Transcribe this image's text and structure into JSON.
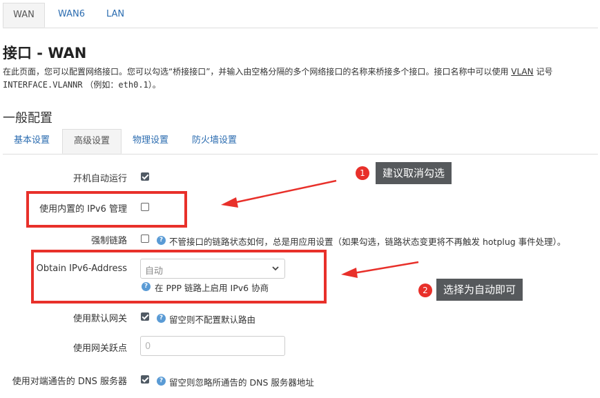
{
  "top_tabs": [
    {
      "label": "WAN",
      "active": true
    },
    {
      "label": "WAN6",
      "active": false
    },
    {
      "label": "LAN",
      "active": false
    }
  ],
  "page": {
    "title": "接口 - WAN",
    "desc_line1_a": "在此页面，您可以配置网络接口。您可以勾选“桥接接口”，并输入由空格分隔的多个网络接口的名称来桥接多个接口。接口名称中可以使用 ",
    "desc_line1_vlan": "VLAN",
    "desc_line1_b": " 记号",
    "desc_line2_code": "INTERFACE.VLANNR",
    "desc_line2_mid": " （例如：",
    "desc_line2_example": "eth0.1",
    "desc_line2_end": "）。"
  },
  "section": {
    "title": "一般配置"
  },
  "sub_tabs": [
    {
      "label": "基本设置",
      "active": false
    },
    {
      "label": "高级设置",
      "active": true
    },
    {
      "label": "物理设置",
      "active": false
    },
    {
      "label": "防火墙设置",
      "active": false
    }
  ],
  "form": {
    "auto_start": {
      "label": "开机自动运行",
      "checked": true
    },
    "ipv6_mgmt": {
      "label": "使用内置的 IPv6 管理",
      "checked": false
    },
    "force_link": {
      "label": "强制链路",
      "checked": false,
      "help": "不管接口的链路状态如何，总是用应用设置（如果勾选，链路状态变更将不再触发 hotplug 事件处理）。"
    },
    "obtain_ipv6": {
      "label": "Obtain IPv6-Address",
      "value": "自动",
      "help": "在 PPP 链路上启用 IPv6 协商"
    },
    "default_gw": {
      "label": "使用默认网关",
      "checked": true,
      "help": "留空则不配置默认路由"
    },
    "gw_metric": {
      "label": "使用网关跃点",
      "placeholder": "0"
    },
    "peer_dns": {
      "label": "使用对端通告的 DNS 服务器",
      "checked": true,
      "help": "留空则忽略所通告的 DNS 服务器地址"
    }
  },
  "annotations": [
    {
      "number": "1",
      "text": "建议取消勾选"
    },
    {
      "number": "2",
      "text": "选择为自动即可"
    }
  ],
  "colors": {
    "accent_red": "#e8302a",
    "callout_bg": "#56595c",
    "link_blue": "#2b6cb0",
    "help_blue": "#5a9bd5"
  }
}
